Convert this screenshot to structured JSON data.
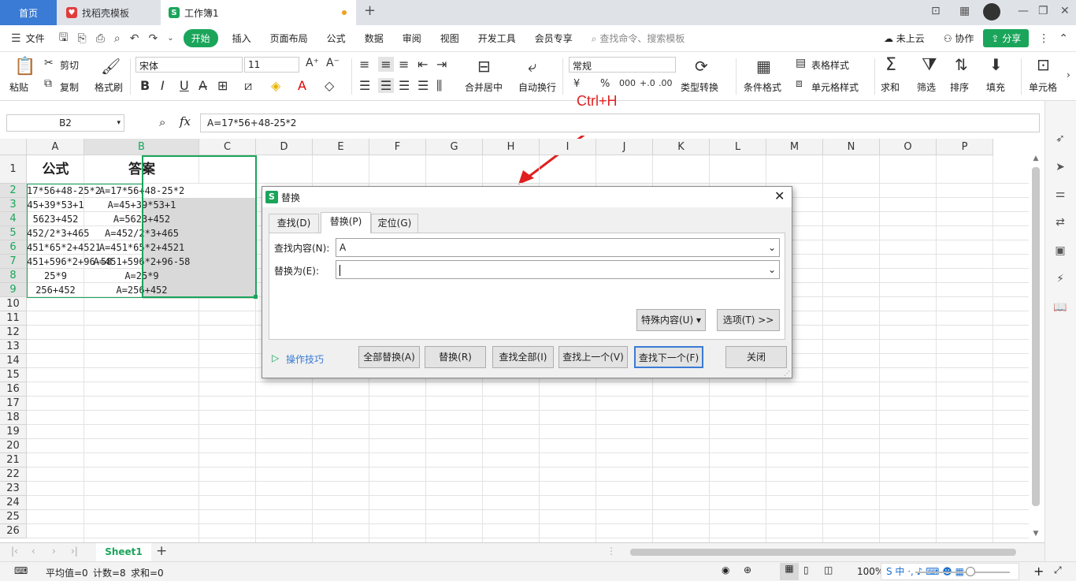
{
  "tabs": {
    "home": "首页",
    "template": "找稻壳模板",
    "workbook": "工作簿1"
  },
  "menu": [
    "文件",
    "开始",
    "插入",
    "页面布局",
    "公式",
    "数据",
    "审阅",
    "视图",
    "开发工具",
    "会员专享"
  ],
  "search_placeholder": "查找命令、搜索模板",
  "cloud": "未上云",
  "collab": "协作",
  "share": "分享",
  "ribbon": {
    "paste": "粘贴",
    "cut": "剪切",
    "copy": "复制",
    "format_painter": "格式刷",
    "font": "宋体",
    "font_size": "11",
    "merge": "合并居中",
    "wrap": "自动换行",
    "number_format": "常规",
    "type_convert": "类型转换",
    "cond_format": "条件格式",
    "table_style": "表格样式",
    "cell_style": "单元格样式",
    "sum": "求和",
    "filter": "筛选",
    "sort": "排序",
    "fill": "填充",
    "cell": "单元格",
    "bold": "B",
    "italic": "I",
    "underline": "U",
    "percent": "%",
    "currency": "¥"
  },
  "name_box": "B2",
  "fx": "fx",
  "formula": "A=17*56+48-25*2",
  "annotation": "Ctrl+H",
  "columns": [
    "A",
    "B",
    "C",
    "D",
    "E",
    "F",
    "G",
    "H",
    "I",
    "J",
    "K",
    "L",
    "M",
    "N",
    "O",
    "P"
  ],
  "rows": [
    "1",
    "2",
    "3",
    "4",
    "5",
    "6",
    "7",
    "8",
    "9",
    "10",
    "11",
    "12",
    "13",
    "14",
    "15",
    "16",
    "17",
    "18",
    "19",
    "20",
    "21",
    "22",
    "23",
    "24",
    "25",
    "26"
  ],
  "headers": {
    "a": "公式",
    "b": "答案"
  },
  "col_a": [
    "17*56+48-25*2",
    "45+39*53+1",
    "5623+452",
    "452/2*3+465",
    "451*65*2+4521",
    "451+596*2+96-58",
    "25*9",
    "256+452"
  ],
  "col_b": [
    "A=17*56+48-25*2",
    "A=45+39*53+1",
    "A=5623+452",
    "A=452/2*3+465",
    "A=451*65*2+4521",
    "A=451+596*2+96-58",
    "A=25*9",
    "A=256+452"
  ],
  "dialog": {
    "title": "替换",
    "tab_find": "查找(D)",
    "tab_replace": "替换(P)",
    "tab_goto": "定位(G)",
    "find_label": "查找内容(N):",
    "find_value": "A",
    "replace_label": "替换为(E):",
    "replace_value": "",
    "special": "特殊内容(U) ▾",
    "options": "选项(T) >>",
    "tips": "操作技巧",
    "replace_all": "全部替换(A)",
    "replace": "替换(R)",
    "find_all": "查找全部(I)",
    "find_prev": "查找上一个(V)",
    "find_next": "查找下一个(F)",
    "close": "关闭"
  },
  "sheet": "Sheet1",
  "status": {
    "avg": "平均值=0",
    "count": "计数=8",
    "sum": "求和=0",
    "zoom": "100%"
  },
  "colors": {
    "accent": "#1aa55a",
    "home_tab": "#3a7bd5",
    "arrow": "#e02020"
  }
}
